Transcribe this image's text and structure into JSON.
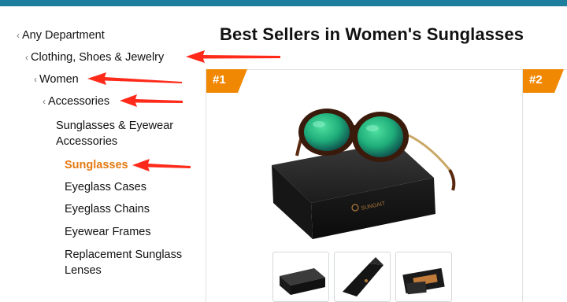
{
  "page": {
    "title": "Best Sellers in Women's Sunglasses"
  },
  "nav": {
    "items": [
      {
        "label": "Any Department"
      },
      {
        "label": "Clothing, Shoes & Jewelry"
      },
      {
        "label": "Women"
      },
      {
        "label": "Accessories"
      },
      {
        "label": "Sunglasses & Eyewear Accessories"
      },
      {
        "label": "Sunglasses",
        "selected": true
      },
      {
        "label": "Eyeglass Cases"
      },
      {
        "label": "Eyeglass Chains"
      },
      {
        "label": "Eyewear Frames"
      },
      {
        "label": "Replacement Sunglass Lenses"
      }
    ]
  },
  "products": [
    {
      "rank": "#1",
      "brand_on_box": "SUNGAIT"
    },
    {
      "rank": "#2"
    }
  ],
  "colors": {
    "top_bar": "#1d7e9e",
    "rank_badge": "#f08804",
    "selected_category": "#e47911",
    "annotation_arrow": "#ff2a1a",
    "lens": "#1fae7a"
  },
  "annotations": {
    "arrows_point_to": [
      "Clothing, Shoes & Jewelry",
      "Women",
      "Accessories",
      "Sunglasses"
    ]
  }
}
